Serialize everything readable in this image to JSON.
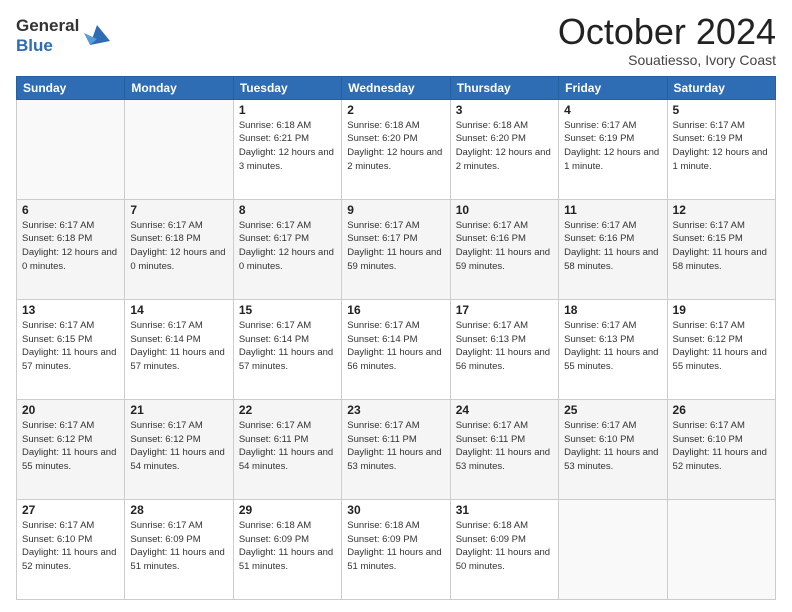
{
  "logo": {
    "general": "General",
    "blue": "Blue"
  },
  "title": "October 2024",
  "location": "Souatiesso, Ivory Coast",
  "days_header": [
    "Sunday",
    "Monday",
    "Tuesday",
    "Wednesday",
    "Thursday",
    "Friday",
    "Saturday"
  ],
  "weeks": [
    [
      {
        "num": "",
        "sunrise": "",
        "sunset": "",
        "daylight": ""
      },
      {
        "num": "",
        "sunrise": "",
        "sunset": "",
        "daylight": ""
      },
      {
        "num": "1",
        "sunrise": "Sunrise: 6:18 AM",
        "sunset": "Sunset: 6:21 PM",
        "daylight": "Daylight: 12 hours and 3 minutes."
      },
      {
        "num": "2",
        "sunrise": "Sunrise: 6:18 AM",
        "sunset": "Sunset: 6:20 PM",
        "daylight": "Daylight: 12 hours and 2 minutes."
      },
      {
        "num": "3",
        "sunrise": "Sunrise: 6:18 AM",
        "sunset": "Sunset: 6:20 PM",
        "daylight": "Daylight: 12 hours and 2 minutes."
      },
      {
        "num": "4",
        "sunrise": "Sunrise: 6:17 AM",
        "sunset": "Sunset: 6:19 PM",
        "daylight": "Daylight: 12 hours and 1 minute."
      },
      {
        "num": "5",
        "sunrise": "Sunrise: 6:17 AM",
        "sunset": "Sunset: 6:19 PM",
        "daylight": "Daylight: 12 hours and 1 minute."
      }
    ],
    [
      {
        "num": "6",
        "sunrise": "Sunrise: 6:17 AM",
        "sunset": "Sunset: 6:18 PM",
        "daylight": "Daylight: 12 hours and 0 minutes."
      },
      {
        "num": "7",
        "sunrise": "Sunrise: 6:17 AM",
        "sunset": "Sunset: 6:18 PM",
        "daylight": "Daylight: 12 hours and 0 minutes."
      },
      {
        "num": "8",
        "sunrise": "Sunrise: 6:17 AM",
        "sunset": "Sunset: 6:17 PM",
        "daylight": "Daylight: 12 hours and 0 minutes."
      },
      {
        "num": "9",
        "sunrise": "Sunrise: 6:17 AM",
        "sunset": "Sunset: 6:17 PM",
        "daylight": "Daylight: 11 hours and 59 minutes."
      },
      {
        "num": "10",
        "sunrise": "Sunrise: 6:17 AM",
        "sunset": "Sunset: 6:16 PM",
        "daylight": "Daylight: 11 hours and 59 minutes."
      },
      {
        "num": "11",
        "sunrise": "Sunrise: 6:17 AM",
        "sunset": "Sunset: 6:16 PM",
        "daylight": "Daylight: 11 hours and 58 minutes."
      },
      {
        "num": "12",
        "sunrise": "Sunrise: 6:17 AM",
        "sunset": "Sunset: 6:15 PM",
        "daylight": "Daylight: 11 hours and 58 minutes."
      }
    ],
    [
      {
        "num": "13",
        "sunrise": "Sunrise: 6:17 AM",
        "sunset": "Sunset: 6:15 PM",
        "daylight": "Daylight: 11 hours and 57 minutes."
      },
      {
        "num": "14",
        "sunrise": "Sunrise: 6:17 AM",
        "sunset": "Sunset: 6:14 PM",
        "daylight": "Daylight: 11 hours and 57 minutes."
      },
      {
        "num": "15",
        "sunrise": "Sunrise: 6:17 AM",
        "sunset": "Sunset: 6:14 PM",
        "daylight": "Daylight: 11 hours and 57 minutes."
      },
      {
        "num": "16",
        "sunrise": "Sunrise: 6:17 AM",
        "sunset": "Sunset: 6:14 PM",
        "daylight": "Daylight: 11 hours and 56 minutes."
      },
      {
        "num": "17",
        "sunrise": "Sunrise: 6:17 AM",
        "sunset": "Sunset: 6:13 PM",
        "daylight": "Daylight: 11 hours and 56 minutes."
      },
      {
        "num": "18",
        "sunrise": "Sunrise: 6:17 AM",
        "sunset": "Sunset: 6:13 PM",
        "daylight": "Daylight: 11 hours and 55 minutes."
      },
      {
        "num": "19",
        "sunrise": "Sunrise: 6:17 AM",
        "sunset": "Sunset: 6:12 PM",
        "daylight": "Daylight: 11 hours and 55 minutes."
      }
    ],
    [
      {
        "num": "20",
        "sunrise": "Sunrise: 6:17 AM",
        "sunset": "Sunset: 6:12 PM",
        "daylight": "Daylight: 11 hours and 55 minutes."
      },
      {
        "num": "21",
        "sunrise": "Sunrise: 6:17 AM",
        "sunset": "Sunset: 6:12 PM",
        "daylight": "Daylight: 11 hours and 54 minutes."
      },
      {
        "num": "22",
        "sunrise": "Sunrise: 6:17 AM",
        "sunset": "Sunset: 6:11 PM",
        "daylight": "Daylight: 11 hours and 54 minutes."
      },
      {
        "num": "23",
        "sunrise": "Sunrise: 6:17 AM",
        "sunset": "Sunset: 6:11 PM",
        "daylight": "Daylight: 11 hours and 53 minutes."
      },
      {
        "num": "24",
        "sunrise": "Sunrise: 6:17 AM",
        "sunset": "Sunset: 6:11 PM",
        "daylight": "Daylight: 11 hours and 53 minutes."
      },
      {
        "num": "25",
        "sunrise": "Sunrise: 6:17 AM",
        "sunset": "Sunset: 6:10 PM",
        "daylight": "Daylight: 11 hours and 53 minutes."
      },
      {
        "num": "26",
        "sunrise": "Sunrise: 6:17 AM",
        "sunset": "Sunset: 6:10 PM",
        "daylight": "Daylight: 11 hours and 52 minutes."
      }
    ],
    [
      {
        "num": "27",
        "sunrise": "Sunrise: 6:17 AM",
        "sunset": "Sunset: 6:10 PM",
        "daylight": "Daylight: 11 hours and 52 minutes."
      },
      {
        "num": "28",
        "sunrise": "Sunrise: 6:17 AM",
        "sunset": "Sunset: 6:09 PM",
        "daylight": "Daylight: 11 hours and 51 minutes."
      },
      {
        "num": "29",
        "sunrise": "Sunrise: 6:18 AM",
        "sunset": "Sunset: 6:09 PM",
        "daylight": "Daylight: 11 hours and 51 minutes."
      },
      {
        "num": "30",
        "sunrise": "Sunrise: 6:18 AM",
        "sunset": "Sunset: 6:09 PM",
        "daylight": "Daylight: 11 hours and 51 minutes."
      },
      {
        "num": "31",
        "sunrise": "Sunrise: 6:18 AM",
        "sunset": "Sunset: 6:09 PM",
        "daylight": "Daylight: 11 hours and 50 minutes."
      },
      {
        "num": "",
        "sunrise": "",
        "sunset": "",
        "daylight": ""
      },
      {
        "num": "",
        "sunrise": "",
        "sunset": "",
        "daylight": ""
      }
    ]
  ]
}
